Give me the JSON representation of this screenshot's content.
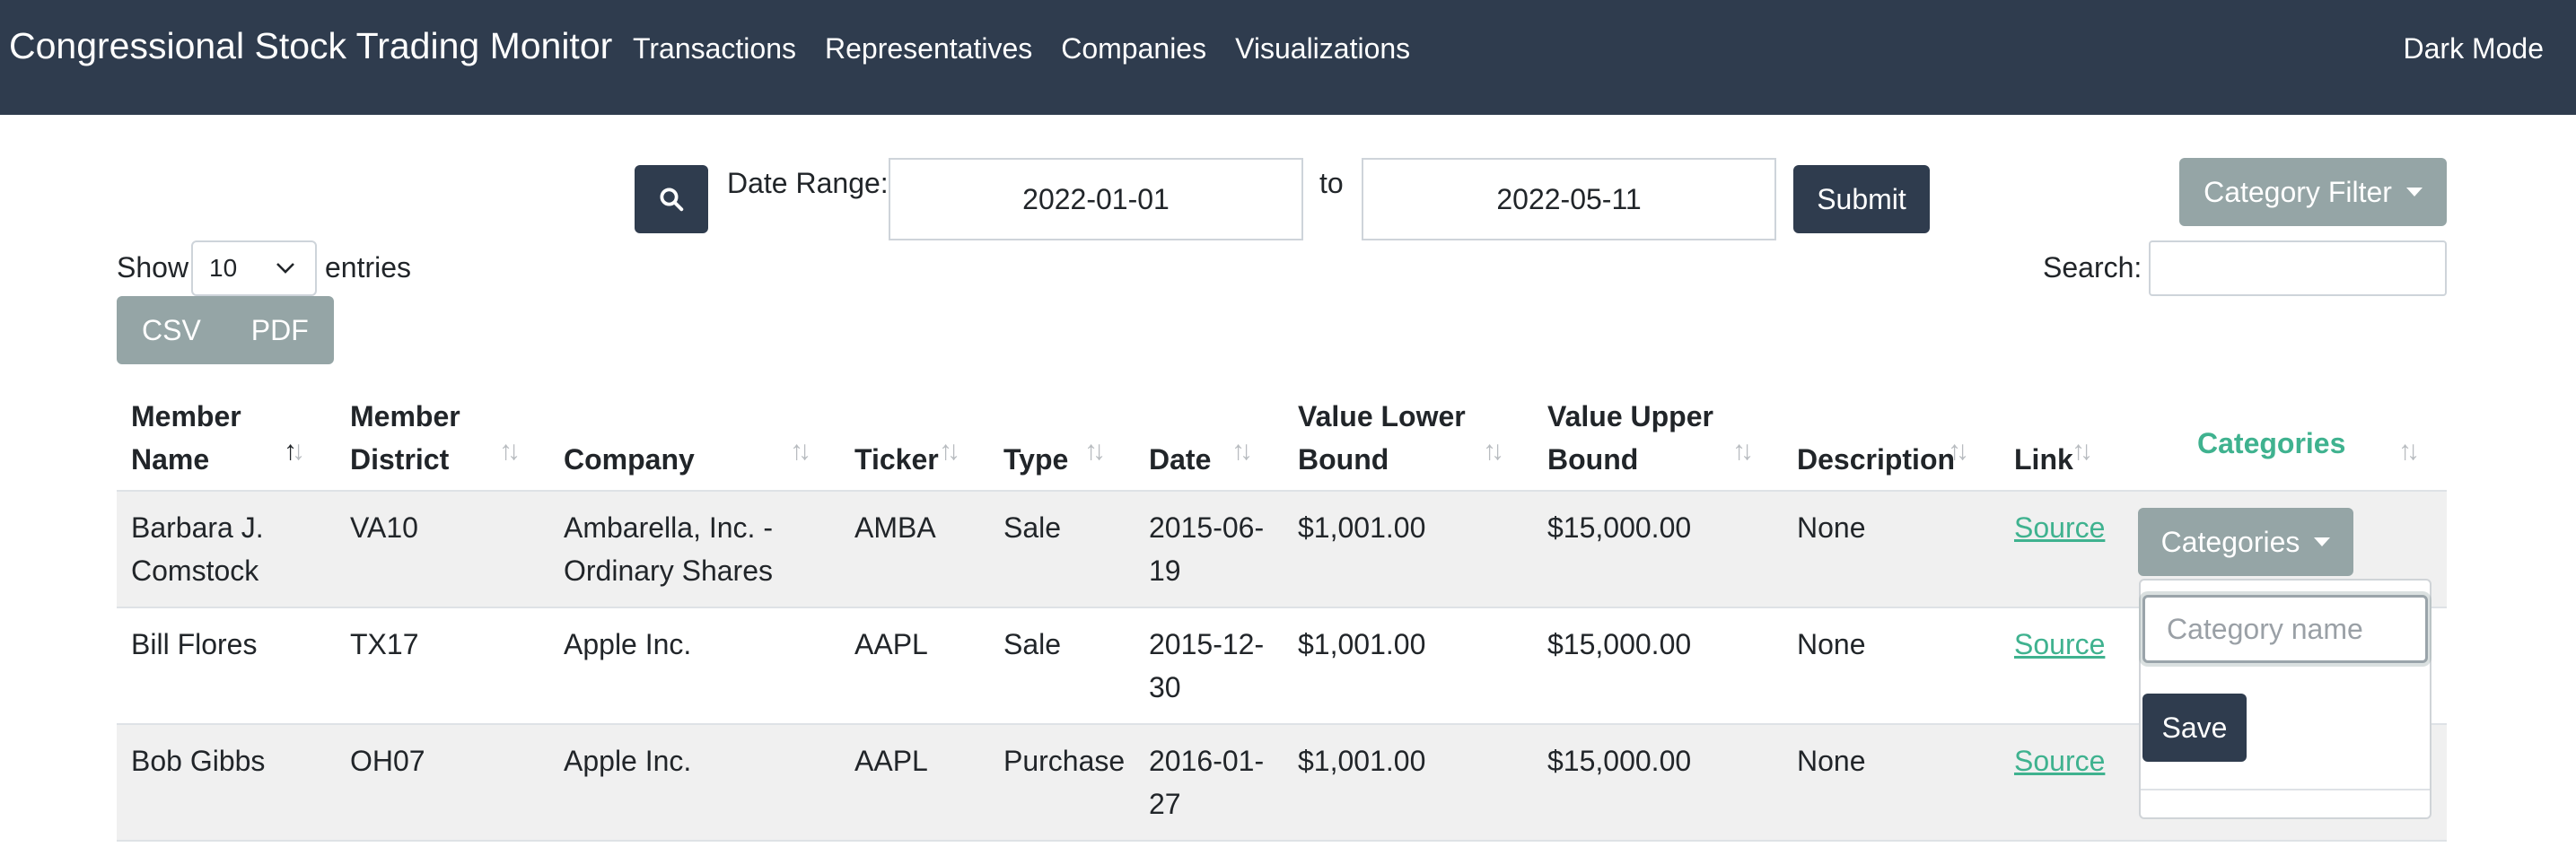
{
  "navbar": {
    "brand": "Congressional Stock Trading Monitor",
    "links": [
      "Transactions",
      "Representatives",
      "Companies",
      "Visualizations"
    ],
    "dark_mode": "Dark Mode"
  },
  "filter": {
    "search_icon": "search-icon",
    "date_range_label": "Date Range:",
    "date_from": "2022-01-01",
    "to_label": "to",
    "date_to": "2022-05-11",
    "submit_label": "Submit",
    "category_filter_label": "Category Filter"
  },
  "table_controls": {
    "show_label": "Show",
    "entries_value": "10",
    "entries_label": "entries",
    "search_label": "Search:",
    "export_buttons": [
      "CSV",
      "PDF"
    ]
  },
  "table": {
    "headers": {
      "member_name": [
        "Member",
        "Name"
      ],
      "member_district": [
        "Member",
        "District"
      ],
      "company": "Company",
      "ticker": "Ticker",
      "type": "Type",
      "date": "Date",
      "value_lower": [
        "Value Lower",
        "Bound"
      ],
      "value_upper": [
        "Value Upper",
        "Bound"
      ],
      "description": "Description",
      "link": "Link",
      "categories": "Categories"
    },
    "rows": [
      {
        "member": [
          "Barbara J.",
          "Comstock"
        ],
        "district": "VA10",
        "company": [
          "Ambarella, Inc. -",
          "Ordinary Shares"
        ],
        "ticker": "AMBA",
        "type": "Sale",
        "date": [
          "2015-06-",
          "19"
        ],
        "value_lower": "$1,001.00",
        "value_upper": "$15,000.00",
        "description": "None",
        "link": "Source",
        "categories_button": "Categories"
      },
      {
        "member": [
          "Bill Flores",
          ""
        ],
        "district": "TX17",
        "company": [
          "Apple Inc.",
          ""
        ],
        "ticker": "AAPL",
        "type": "Sale",
        "date": [
          "2015-12-",
          "30"
        ],
        "value_lower": "$1,001.00",
        "value_upper": "$15,000.00",
        "description": "None",
        "link": "Source"
      },
      {
        "member": [
          "Bob Gibbs",
          ""
        ],
        "district": "OH07",
        "company": [
          "Apple Inc.",
          ""
        ],
        "ticker": "AAPL",
        "type": "Purchase",
        "date": [
          "2016-01-",
          "27"
        ],
        "value_lower": "$1,001.00",
        "value_upper": "$15,000.00",
        "description": "None",
        "link": "Source"
      }
    ]
  },
  "category_dropdown": {
    "placeholder": "Category name",
    "save_label": "Save"
  },
  "colors": {
    "navbar": "#2f3c4e",
    "accent_green": "#3fb28f",
    "secondary_gray": "#95a5a6"
  }
}
